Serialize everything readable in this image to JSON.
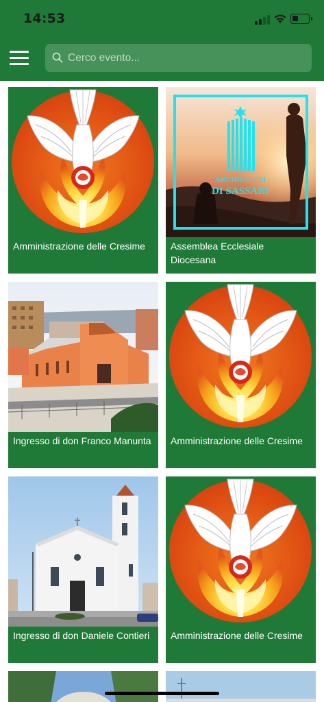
{
  "status_bar": {
    "time": "14:53"
  },
  "header": {
    "menu_icon": "hamburger-icon",
    "search_icon": "search-icon",
    "search_placeholder": "Cerco evento..."
  },
  "events": [
    {
      "title": "Amministrazione delle Cresime",
      "image": "holy-spirit-dove-logo"
    },
    {
      "title": "Assemblea Ecclesiale Diocesana",
      "image": "arcidiocesi-sassari-sunset"
    },
    {
      "title": "Ingresso di don Franco Manunta",
      "image": "orange-church-photo"
    },
    {
      "title": "Amministrazione delle Cresime",
      "image": "holy-spirit-dove-logo"
    },
    {
      "title": "Ingresso di don Daniele Contieri",
      "image": "white-church-photo"
    },
    {
      "title": "Amministrazione delle Cresime",
      "image": "holy-spirit-dove-logo"
    }
  ],
  "logo_text": {
    "line1": "ARCIDIOCESI",
    "line2": "DI SASSARI"
  },
  "colors": {
    "header_green": "#1f7a37",
    "card_green": "#1f7a37",
    "logo_orange": "#e2581a",
    "logo_cyan": "#1fe3f0"
  }
}
